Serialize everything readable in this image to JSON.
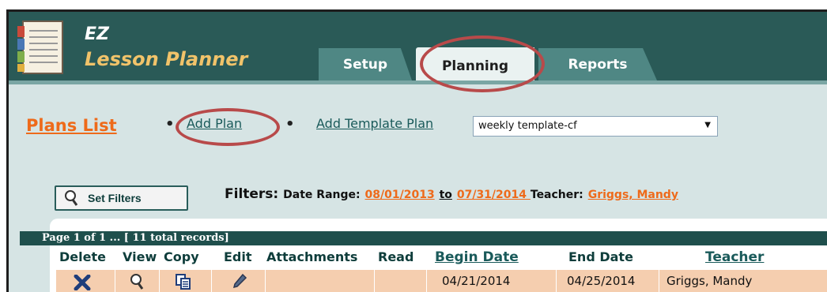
{
  "brand": {
    "line1": "EZ",
    "line2": "Lesson Planner"
  },
  "tabs": [
    {
      "label": "Setup",
      "active": false
    },
    {
      "label": "Planning",
      "active": true
    },
    {
      "label": "Reports",
      "active": false
    }
  ],
  "nav": {
    "plans_list": "Plans List",
    "bullet": "•",
    "add_plan": "Add Plan",
    "add_template_plan": "Add Template Plan",
    "template_select": {
      "value": "weekly template-cf"
    }
  },
  "filters": {
    "button_label": "Set Filters",
    "title": "Filters:",
    "date_range_label": "Date Range:",
    "date_from": "08/01/2013",
    "to_word": "to",
    "date_to": "07/31/2014 ",
    "teacher_label": "Teacher:",
    "teacher_value": "Griggs, Mandy"
  },
  "table": {
    "page_info": "Page 1 of 1 ... [ 11 total records]",
    "columns": [
      "Delete",
      "View",
      "Copy",
      "Edit",
      "Attachments",
      "Read",
      "Begin Date",
      "End Date",
      "Teacher"
    ],
    "rows": [
      {
        "begin_date": "04/21/2014",
        "end_date": "04/25/2014",
        "teacher": "Griggs, Mandy"
      }
    ]
  },
  "colors": {
    "header_bg": "#2a5a57",
    "tab_bg": "#4f8784",
    "accent_orange": "#ee6a1a",
    "annotation_red": "#b84a4a",
    "row_bg": "#f5ceaf"
  },
  "icons": {
    "logo": "notebook-icon",
    "set_filters": "magnifier-icon",
    "delete": "x-icon",
    "view": "magnifier-icon",
    "copy": "copy-icon",
    "edit": "pencil-icon"
  }
}
